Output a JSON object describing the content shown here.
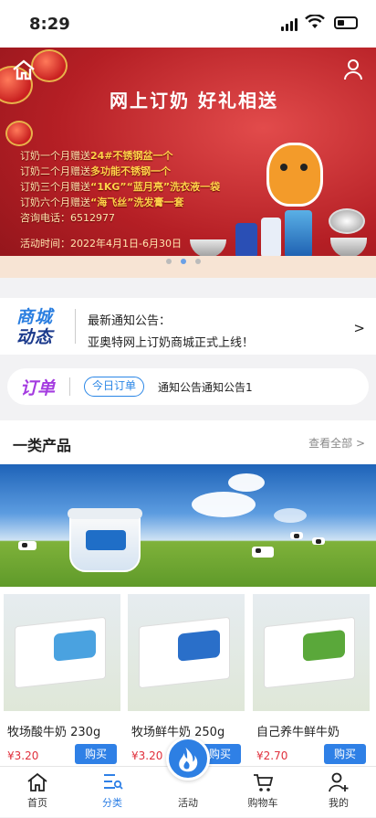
{
  "status_bar": {
    "time": "8:29"
  },
  "banner": {
    "headline": "网上订奶  好礼相送",
    "offers": [
      {
        "prefix": "订奶一个月赠送",
        "gift": "24#不锈钢盆一个"
      },
      {
        "prefix": "订奶二个月赠送",
        "gift": "多功能不锈钢一个"
      },
      {
        "prefix": "订奶三个月赠送",
        "gift": "“1KG”“蓝月亮”洗衣液一袋"
      },
      {
        "prefix": "订奶六个月赠送",
        "gift": "“海飞丝”洗发膏一套"
      }
    ],
    "phone": "咨询电话：6512977",
    "period": "活动时间：2022年4月1日-6月30日",
    "page_count": 3,
    "active_page": 2
  },
  "notice": {
    "logo_line1": "商城",
    "logo_line2": "动态",
    "title": "最新通知公告：",
    "text": "亚奥特网上订奶商城正式上线！",
    "arrow": ">"
  },
  "order": {
    "label": "订单",
    "pill": "今日订单",
    "message": "通知公告通知公告1"
  },
  "section": {
    "title": "一类产品",
    "more": "查看全部 >"
  },
  "products": [
    {
      "name": "牧场酸牛奶  230g",
      "price": "¥3.20",
      "buy": "购买",
      "accent": "#4aa2e0"
    },
    {
      "name": "牧场鲜牛奶  250g",
      "price": "¥3.20",
      "buy": "购买",
      "accent": "#2a6fc9"
    },
    {
      "name": "自己养牛鲜牛奶",
      "price": "¥2.70",
      "buy": "购买",
      "accent": "#5aa83a"
    }
  ],
  "tabbar": {
    "home": "首页",
    "category": "分类",
    "activity": "活动",
    "cart": "购物车",
    "mine": "我的"
  },
  "colors": {
    "accent": "#2f80e6",
    "price": "#e0303c",
    "banner_red": "#b51f25"
  }
}
